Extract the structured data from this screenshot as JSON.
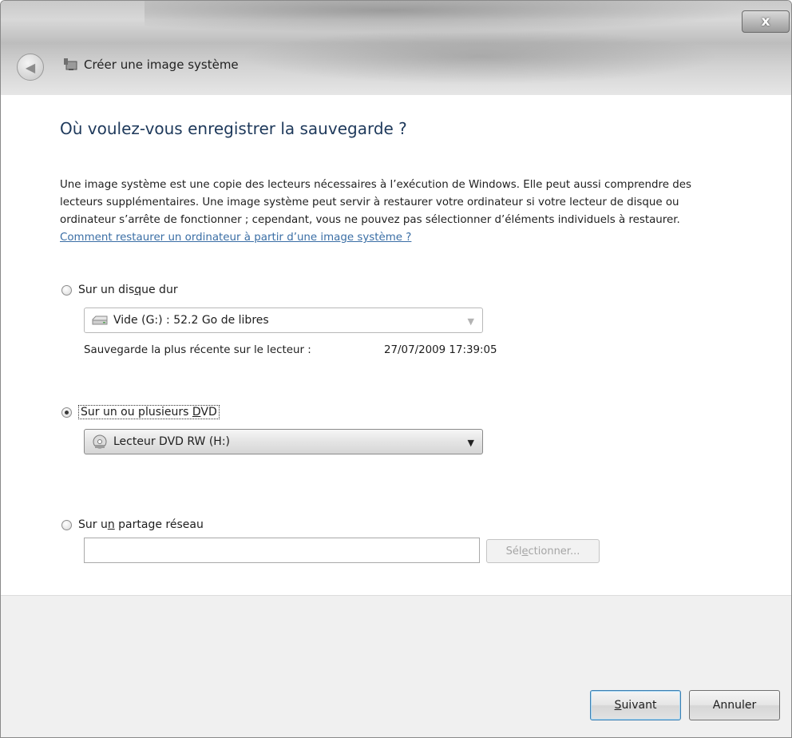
{
  "window": {
    "title": "Créer une image système",
    "close_label": "x"
  },
  "main": {
    "heading": "Où voulez-vous enregistrer la sauvegarde ?",
    "description": "Une image système est une copie des lecteurs nécessaires à l’exécution de Windows. Elle peut aussi comprendre des lecteurs supplémentaires. Une image système peut servir à restaurer votre ordinateur si votre lecteur de disque ou ordinateur s’arrête de fonctionner ; cependant, vous ne pouvez pas sélectionner d’éléments individuels à restaurer.",
    "help_link": "Comment restaurer un ordinateur à partir d’une image système ?"
  },
  "options": {
    "hard_disk": {
      "label_pre": "Sur un dis",
      "label_key": "q",
      "label_post": "ue dur",
      "selected": false,
      "dropdown_value": "Vide (G:) : 52.2 Go de libres",
      "dropdown_icon": "hard-drive-icon",
      "last_backup_label": "Sauvegarde la plus récente sur le lecteur :",
      "last_backup_value": "27/07/2009 17:39:05"
    },
    "dvd": {
      "label_pre": "Sur un ou plusieurs ",
      "label_key": "D",
      "label_post": "VD",
      "selected": true,
      "dropdown_value": "Lecteur DVD RW (H:)",
      "dropdown_icon": "dvd-drive-icon"
    },
    "network": {
      "label_pre": "Sur u",
      "label_key": "n",
      "label_post": " partage réseau",
      "selected": false,
      "input_value": "",
      "button_pre": "Sél",
      "button_key": "e",
      "button_post": "ctionner..."
    }
  },
  "footer": {
    "next_key": "S",
    "next_rest": "uivant",
    "cancel": "Annuler"
  }
}
